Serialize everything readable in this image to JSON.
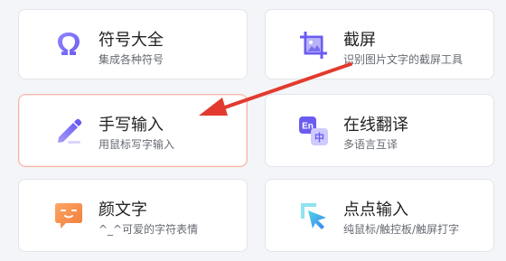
{
  "cards": [
    {
      "title": "符号大全",
      "subtitle": "集成各种符号",
      "icon": "omega-icon"
    },
    {
      "title": "截屏",
      "subtitle": "识别图片文字的截屏工具",
      "icon": "screenshot-crop-icon"
    },
    {
      "title": "手写输入",
      "subtitle": "用鼠标写字输入",
      "icon": "pencil-icon"
    },
    {
      "title": "在线翻译",
      "subtitle": "多语言互译",
      "icon": "translate-icon",
      "icon_text_1": "En",
      "icon_text_2": "中"
    },
    {
      "title": "颜文字",
      "subtitle": "^_^可爱的字符表情",
      "icon": "emoticon-icon"
    },
    {
      "title": "点点输入",
      "subtitle": "纯鼠标/触控板/触屏打字",
      "icon": "cursor-click-icon"
    }
  ],
  "colors": {
    "purple": "#7b6ff0",
    "orange": "#f08a4b",
    "annotation_red": "#e23a2e",
    "active_border": "#f6b6a6"
  }
}
